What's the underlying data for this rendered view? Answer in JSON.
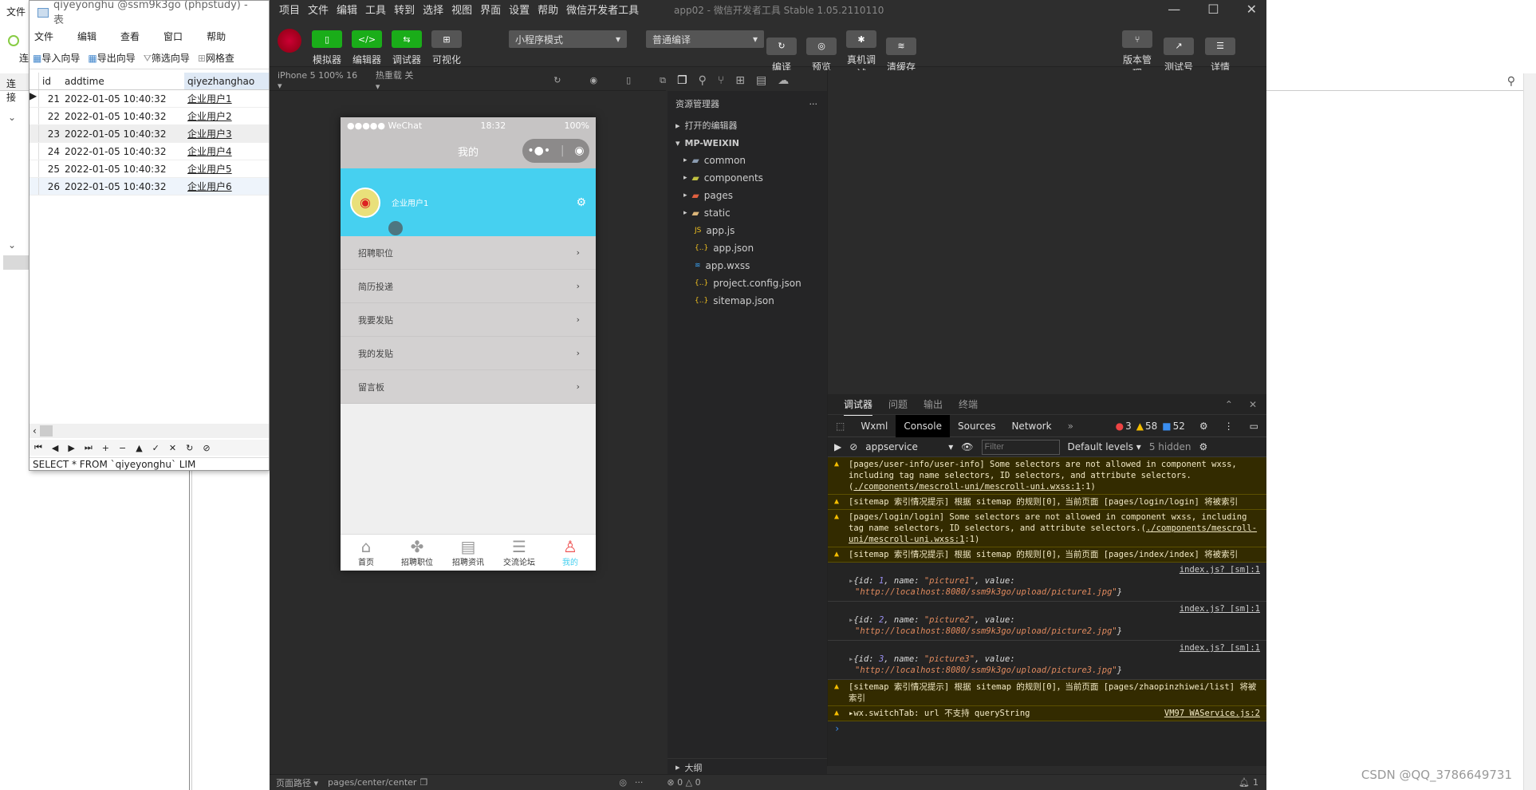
{
  "navicat_main": {
    "menu_file": "文件",
    "conn_label": "连接",
    "toolbar_partial": "连"
  },
  "navicat": {
    "title": "qiyeyonghu @ssm9k3go (phpstudy) - 表",
    "menu": [
      "文件",
      "编辑",
      "查看",
      "窗口",
      "帮助"
    ],
    "toolbar": [
      "导入向导",
      "导出向导",
      "筛选向导",
      "网格查"
    ],
    "columns": [
      "id",
      "addtime",
      "qiyezhanghao"
    ],
    "rows": [
      {
        "id": "21",
        "addtime": "2022-01-05 10:40:32",
        "qiyezhanghao": "企业用户1"
      },
      {
        "id": "22",
        "addtime": "2022-01-05 10:40:32",
        "qiyezhanghao": "企业用户2"
      },
      {
        "id": "23",
        "addtime": "2022-01-05 10:40:32",
        "qiyezhanghao": "企业用户3"
      },
      {
        "id": "24",
        "addtime": "2022-01-05 10:40:32",
        "qiyezhanghao": "企业用户4"
      },
      {
        "id": "25",
        "addtime": "2022-01-05 10:40:32",
        "qiyezhanghao": "企业用户5"
      },
      {
        "id": "26",
        "addtime": "2022-01-05 10:40:32",
        "qiyezhanghao": "企业用户6"
      }
    ],
    "nav_buttons": [
      "⏮",
      "◀",
      "▶",
      "⏭",
      "+",
      "−",
      "▲",
      "✓",
      "✕",
      "↻",
      "⊘"
    ],
    "sql": "SELECT * FROM `qiyeyonghu` LIM"
  },
  "devtools": {
    "menu": [
      "项目",
      "文件",
      "编辑",
      "工具",
      "转到",
      "选择",
      "视图",
      "界面",
      "设置",
      "帮助",
      "微信开发者工具"
    ],
    "window_title": "app02 - 微信开发者工具 Stable 1.05.2110110",
    "left_buttons": [
      {
        "label": "模拟器",
        "icon": "▯"
      },
      {
        "label": "编辑器",
        "icon": "</>"
      },
      {
        "label": "调试器",
        "icon": "⇆"
      },
      {
        "label": "可视化",
        "icon": "⊞"
      }
    ],
    "mode_select": "小程序模式",
    "compile_select": "普通编译",
    "mid_buttons": [
      {
        "label": "编译",
        "icon": "↻"
      },
      {
        "label": "预览",
        "icon": "◎"
      },
      {
        "label": "真机调试",
        "icon": "✱"
      },
      {
        "label": "清缓存",
        "icon": "≋"
      }
    ],
    "right_buttons": [
      {
        "label": "版本管理",
        "icon": "⑂"
      },
      {
        "label": "测试号",
        "icon": "↗"
      },
      {
        "label": "详情",
        "icon": "☰"
      }
    ],
    "sim_device": "iPhone 5 100% 16 ▾",
    "hot_reload": "热重载 关 ▾",
    "explorer": {
      "title": "资源管理器",
      "open_editors": "打开的编辑器",
      "project": "MP-WEIXIN",
      "items": [
        {
          "name": "common",
          "type": "folder",
          "color": "#8a9bb0"
        },
        {
          "name": "components",
          "type": "folder",
          "color": "#c0c040"
        },
        {
          "name": "pages",
          "type": "folder",
          "color": "#e06040"
        },
        {
          "name": "static",
          "type": "folder",
          "color": "#dcb67a"
        },
        {
          "name": "app.js",
          "type": "js",
          "color": "#f0c020"
        },
        {
          "name": "app.json",
          "type": "json",
          "color": "#f0c020"
        },
        {
          "name": "app.wxss",
          "type": "wxss",
          "color": "#3aa0f0"
        },
        {
          "name": "project.config.json",
          "type": "json",
          "color": "#f0c020"
        },
        {
          "name": "sitemap.json",
          "type": "json",
          "color": "#f0c020"
        }
      ],
      "outline": "大纲"
    },
    "phone": {
      "carrier": "●●●●● WeChat",
      "time": "18:32",
      "battery": "100%",
      "nav_title": "我的",
      "username": "企业用户1",
      "menu": [
        "招聘职位",
        "简历投递",
        "我要发贴",
        "我的发贴",
        "留言板"
      ],
      "tabs": [
        {
          "label": "首页",
          "icon": "⌂"
        },
        {
          "label": "招聘职位",
          "icon": "✤"
        },
        {
          "label": "招聘资讯",
          "icon": "▤"
        },
        {
          "label": "交流论坛",
          "icon": "☰"
        },
        {
          "label": "我的",
          "icon": "♙"
        }
      ],
      "active_tab_color": "#46d0f0",
      "header_color": "#46d0f0"
    },
    "debugger": {
      "panel_tabs": [
        "调试器",
        "问题",
        "输出",
        "终端"
      ],
      "dev_tabs": [
        "Wxml",
        "Console",
        "Sources",
        "Network",
        "»"
      ],
      "errors": "3",
      "warnings": "58",
      "infos": "52",
      "context": "appservice",
      "filter_placeholder": "Filter",
      "levels": "Default levels ▾",
      "hidden": "5 hidden",
      "messages": [
        {
          "type": "warn",
          "text": "[pages/user-info/user-info] Some selectors are not allowed in component wxss, including tag name selectors, ID selectors, and attribute selectors.(",
          "link": "./components/mescroll-uni/mescroll-uni.wxss:1",
          "tail": ":1)"
        },
        {
          "type": "warn",
          "text": "[sitemap 索引情况提示] 根据 sitemap 的规则[0]，当前页面 [pages/login/login] 将被索引"
        },
        {
          "type": "warn",
          "text": "[pages/login/login] Some selectors are not allowed in component wxss, including tag name selectors, ID selectors, and attribute selectors.(",
          "link": "./components/mescroll-uni/mescroll-uni.wxss:1",
          "tail": ":1)"
        },
        {
          "type": "warn",
          "text": "[sitemap 索引情况提示] 根据 sitemap 的规则[0]，当前页面 [pages/index/index] 将被索引"
        },
        {
          "type": "log",
          "source": "index.js? [sm]:1",
          "id": "1",
          "name": "\"picture1\"",
          "value": "\"http://localhost:8080/ssm9k3go/upload/picture1.jpg\""
        },
        {
          "type": "log",
          "source": "index.js? [sm]:1",
          "id": "2",
          "name": "\"picture2\"",
          "value": "\"http://localhost:8080/ssm9k3go/upload/picture2.jpg\""
        },
        {
          "type": "log",
          "source": "index.js? [sm]:1",
          "id": "3",
          "name": "\"picture3\"",
          "value": "\"http://localhost:8080/ssm9k3go/upload/picture3.jpg\""
        },
        {
          "type": "warn",
          "text": "[sitemap 索引情况提示] 根据 sitemap 的规则[0]，当前页面 [pages/zhaopinzhiwei/list] 将被索引"
        },
        {
          "type": "warn",
          "text": "▸wx.switchTab: url 不支持 queryString",
          "source": "VM97 WAService.js:2"
        }
      ]
    },
    "status": {
      "page_path_label": "页面路径 ▾",
      "page_path": "pages/center/center",
      "problems": "⊗ 0 △ 0",
      "notifications": "1"
    }
  },
  "watermark": "CSDN @QQ_3786649731"
}
